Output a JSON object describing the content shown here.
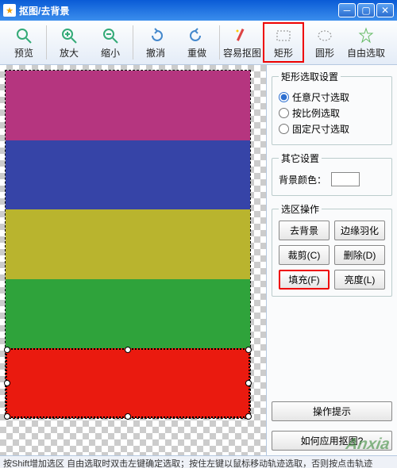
{
  "window": {
    "title": "抠图/去背景"
  },
  "toolbar": {
    "preview": "预览",
    "zoom_in": "放大",
    "zoom_out": "缩小",
    "undo": "撤消",
    "redo": "重做",
    "easy_cutout": "容易抠图",
    "rectangle": "矩形",
    "ellipse": "圆形",
    "freehand": "自由选取"
  },
  "sidebar": {
    "rect_settings": {
      "legend": "矩形选取设置",
      "opt_any": "任意尺寸选取",
      "opt_ratio": "按比例选取",
      "opt_fixed": "固定尺寸选取"
    },
    "other_settings": {
      "legend": "其它设置",
      "bg_color_label": "背景颜色："
    },
    "selection_ops": {
      "legend": "选区操作",
      "remove_bg": "去背景",
      "feather": "边缘羽化",
      "crop": "裁剪(C)",
      "delete": "删除(D)",
      "fill": "填充(F)",
      "brightness": "亮度(L)"
    },
    "hints": "操作提示",
    "how_to": "如何应用抠图?"
  },
  "statusbar": {
    "text": "按Shift增加选区  自由选取时双击左键确定选取；按住左键以鼠标移动轨迹选取，否则按点击轨迹"
  },
  "watermark": "Anxia"
}
